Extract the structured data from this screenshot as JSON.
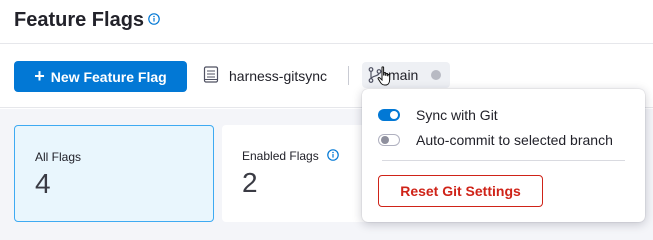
{
  "header": {
    "title": "Feature Flags",
    "info_icon": "info-icon"
  },
  "toolbar": {
    "new_flag_label": "New Feature Flag",
    "new_flag_icon": "plus-icon",
    "repo_name": "harness-gitsync",
    "repo_icon": "repository-icon",
    "branch_name": "main",
    "branch_icon": "git-branch-icon"
  },
  "stats": [
    {
      "label": "All Flags",
      "value": "4",
      "active": true
    },
    {
      "label": "Enabled Flags",
      "value": "2",
      "active": false,
      "info_icon": "info-icon"
    }
  ],
  "git_popover": {
    "sync_label": "Sync with Git",
    "sync_enabled": true,
    "autocommit_label": "Auto-commit to selected branch",
    "autocommit_enabled": false,
    "reset_label": "Reset Git Settings"
  },
  "colors": {
    "primary": "#0278d5",
    "danger": "#cf2318",
    "active_card_bg": "#e9f6fd",
    "active_card_border": "#3eaaf2",
    "content_bg": "#f4f5f9"
  }
}
